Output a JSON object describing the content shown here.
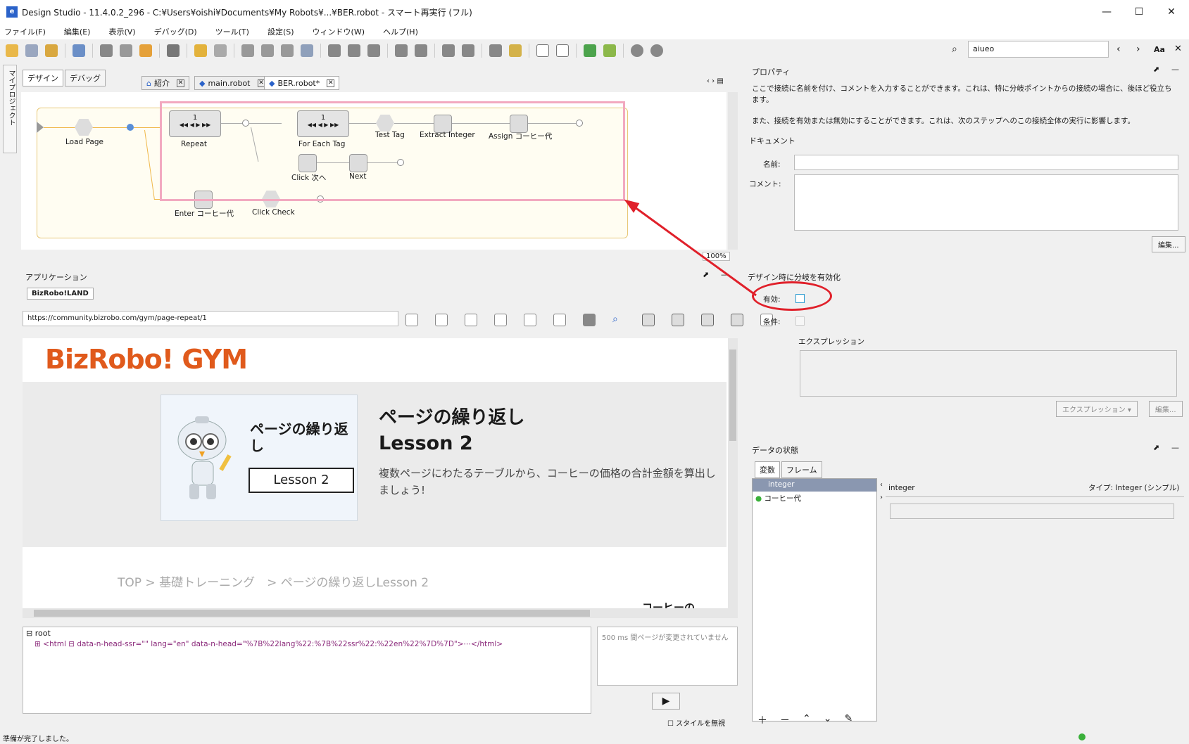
{
  "window": {
    "title": "Design Studio - 11.4.0.2_296 - C:¥Users¥oishi¥Documents¥My Robots¥...¥BER.robot - スマート再実行 (フル)",
    "minimize": "—",
    "maximize": "☐",
    "close": "✕"
  },
  "menu": [
    "ファイル(F)",
    "編集(E)",
    "表示(V)",
    "デバッグ(D)",
    "ツール(T)",
    "設定(S)",
    "ウィンドウ(W)",
    "ヘルプ(H)"
  ],
  "search": {
    "value": "aiueo",
    "case_label": "Aa"
  },
  "left_strip": "マイプロジェクト",
  "mode_tabs": {
    "design": "デザイン",
    "debug": "デバッグ"
  },
  "editor_tabs": [
    {
      "label": "紹介"
    },
    {
      "label": "main.robot"
    },
    {
      "label": "BER.robot*"
    }
  ],
  "flow": {
    "nodes": {
      "load_page": "Load Page",
      "repeat": "Repeat",
      "for_each_tag": "For Each Tag",
      "test_tag": "Test Tag",
      "extract_integer": "Extract Integer",
      "assign": "Assign コーヒー代",
      "click_next": "Click 次へ",
      "next": "Next",
      "enter": "Enter コーヒー代",
      "click_check": "Click Check"
    },
    "repeat_counter": "1",
    "foreach_counter": "1",
    "zoom": "100%"
  },
  "application": {
    "title": "アプリケーション",
    "tab": "BizRobo!LAND",
    "url": "https://community.bizrobo.com/gym/page-repeat/1"
  },
  "page": {
    "logo": "BizRobo! GYM",
    "card_title": "ページの繰り返し",
    "card_button": "Lesson 2",
    "lesson_title": "ページの繰り返し",
    "lesson_sub": "Lesson 2",
    "lesson_desc": "複数ページにわたるテーブルから、コーヒーの価格の合計金額を算出しましょう!",
    "breadcrumb": "TOP > 基礎トレーニング　> ページの繰り返しLesson 2",
    "cut_text": "コーヒーの"
  },
  "dom": {
    "root": "root",
    "html_line": "<html ⊟ data-n-head-ssr=\"\" lang=\"en\" data-n-head=\"%7B%22lang%22:%7B%22ssr%22:%22en%22%7D%7D\">⋯</html>"
  },
  "timer": {
    "text": "500 ms 間ページが変更されていません"
  },
  "ignore_style": "スタイルを無視",
  "status": "準備が完了しました。",
  "properties": {
    "title": "プロパティ",
    "desc1": "ここで接続に名前を付け、コメントを入力することができます。これは、特に分岐ポイントからの接続の場合に、後ほど役立ちます。",
    "desc2": "また、接続を有効または無効にすることができます。これは、次のステップへのこの接続全体の実行に影響します。",
    "document": "ドキュメント",
    "name_label": "名前:",
    "comment_label": "コメント:",
    "edit_btn": "編集...",
    "enable_section": "デザイン時に分岐を有効化",
    "enabled_label": "有効:",
    "condition_label": "条件:",
    "expression_label": "エクスプレッション",
    "expression_btn": "エクスプレッション ▾",
    "edit_btn2": "編集..."
  },
  "data_state": {
    "title": "データの状態",
    "tabs": [
      "変数",
      "フレーム"
    ],
    "list": [
      "integer",
      "コーヒー代"
    ],
    "detail_name": "integer",
    "detail_type": "タイプ: Integer (シンプル)"
  },
  "colors": {
    "accent": "#2a62c9",
    "logo": "#e05a1c",
    "highlight": "#f2a9c0",
    "annotation": "#e0202a"
  }
}
